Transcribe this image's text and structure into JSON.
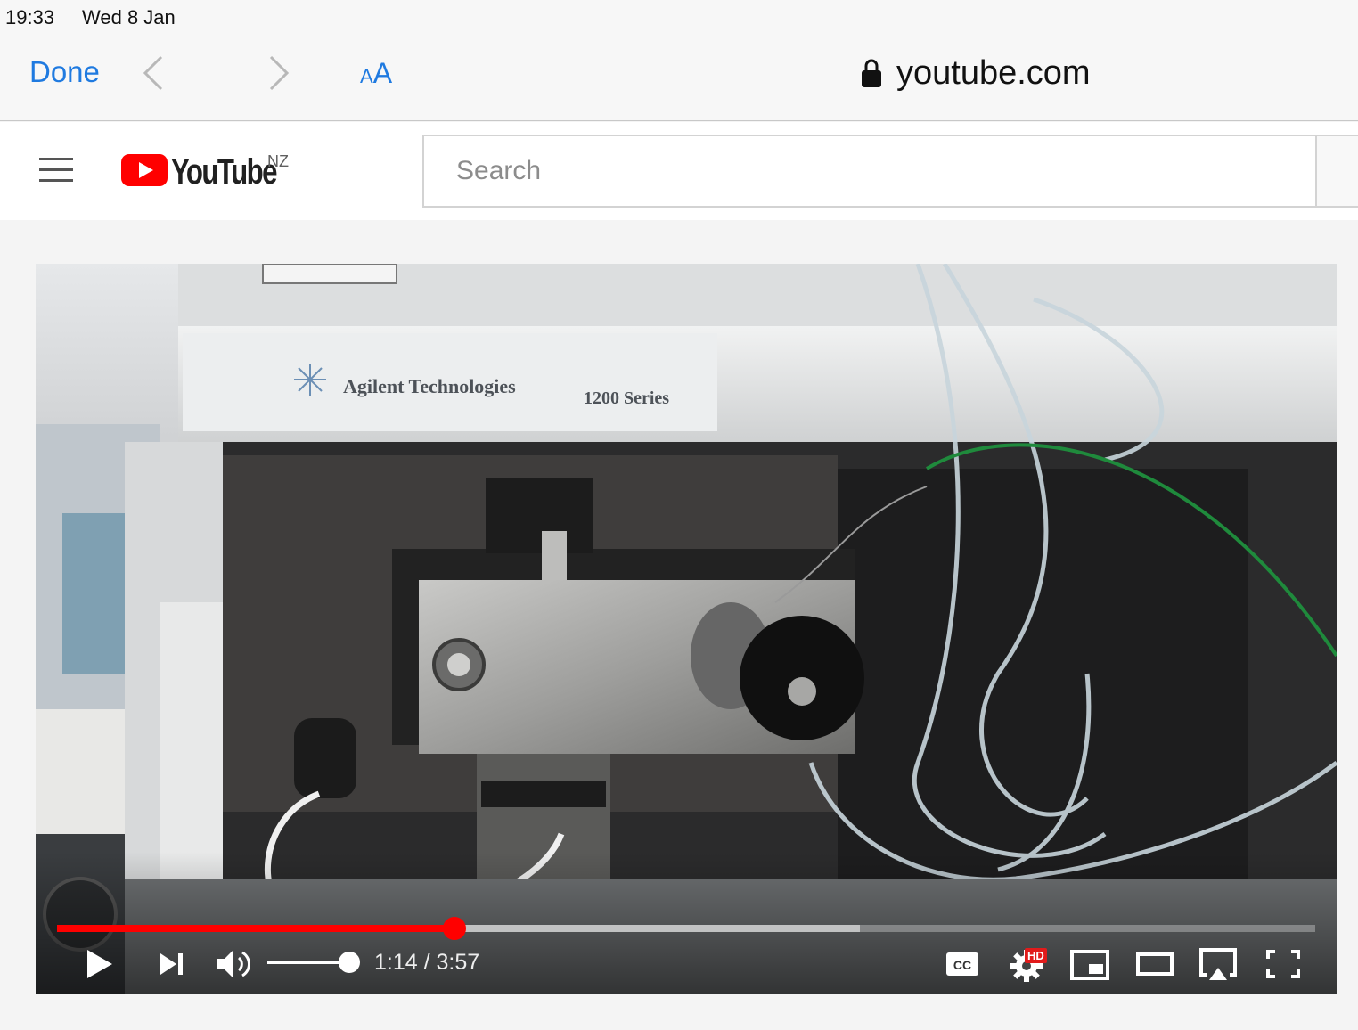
{
  "status_bar": {
    "time": "19:33",
    "date": "Wed 8 Jan"
  },
  "safari": {
    "done_label": "Done",
    "text_size_small": "A",
    "text_size_big": "A",
    "url": "youtube.com"
  },
  "youtube": {
    "wordmark": "YouTube",
    "region": "NZ",
    "search_placeholder": "Search"
  },
  "video": {
    "device_brand": "Agilent Technologies",
    "device_series": "1200 Series",
    "elapsed": "1:14",
    "duration": "3:57",
    "time_text": "1:14 / 3:57",
    "played_fraction": 0.316,
    "buffered_fraction": 0.638,
    "volume_fraction": 1.0,
    "hd": "HD"
  },
  "colors": {
    "accent": "#1f7ae0",
    "youtube_red": "#ff0000"
  }
}
